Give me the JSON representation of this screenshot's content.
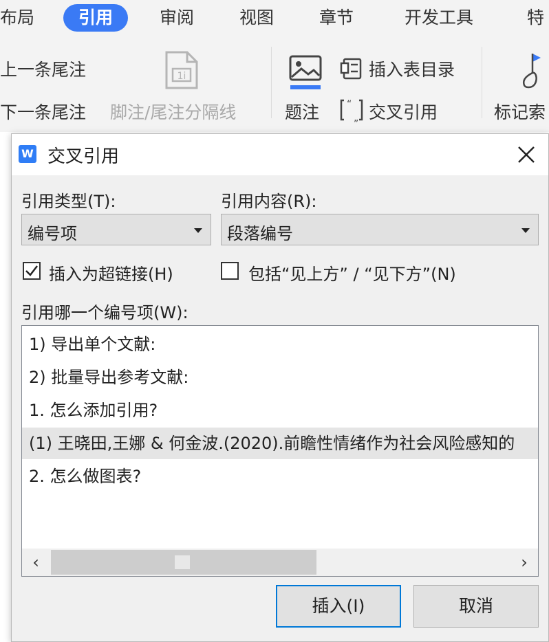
{
  "ribbon_tabs": {
    "layout": "布局",
    "references": "引用",
    "review": "审阅",
    "view": "视图",
    "sections": "章节",
    "dev_tools": "开发工具",
    "special": "特"
  },
  "ribbon": {
    "prev_endnote": "上一条尾注",
    "next_endnote": "下一条尾注",
    "footnote_separator": "脚注/尾注分隔线",
    "caption": "题注",
    "insert_table_of_figures": "插入表目录",
    "cross_reference": "交叉引用",
    "mark_entry": "标记索"
  },
  "dialog": {
    "app_icon_letter": "W",
    "title": "交叉引用",
    "ref_type_label": "引用类型(T):",
    "ref_type_value": "编号项",
    "ref_content_label": "引用内容(R):",
    "ref_content_value": "段落编号",
    "insert_hyperlink_label": "插入为超链接(H)",
    "insert_hyperlink_checked": true,
    "include_above_below_label": "包括“见上方”  /  “见下方”(N)",
    "include_above_below_checked": false,
    "which_item_label": "引用哪一个编号项(W):",
    "items": [
      "1)    导出单个文献:",
      "2)    批量导出参考文献:",
      "1. 怎么添加引用?",
      "(1) 王晓田,王娜 & 何金波.(2020).前瞻性情绪作为社会风险感知的",
      "2. 怎么做图表?"
    ],
    "selected_index": 3,
    "insert_button": "插入(I)",
    "cancel_button": "取消"
  },
  "colors": {
    "accent": "#3a7af5",
    "focus_border": "#0078d7"
  }
}
